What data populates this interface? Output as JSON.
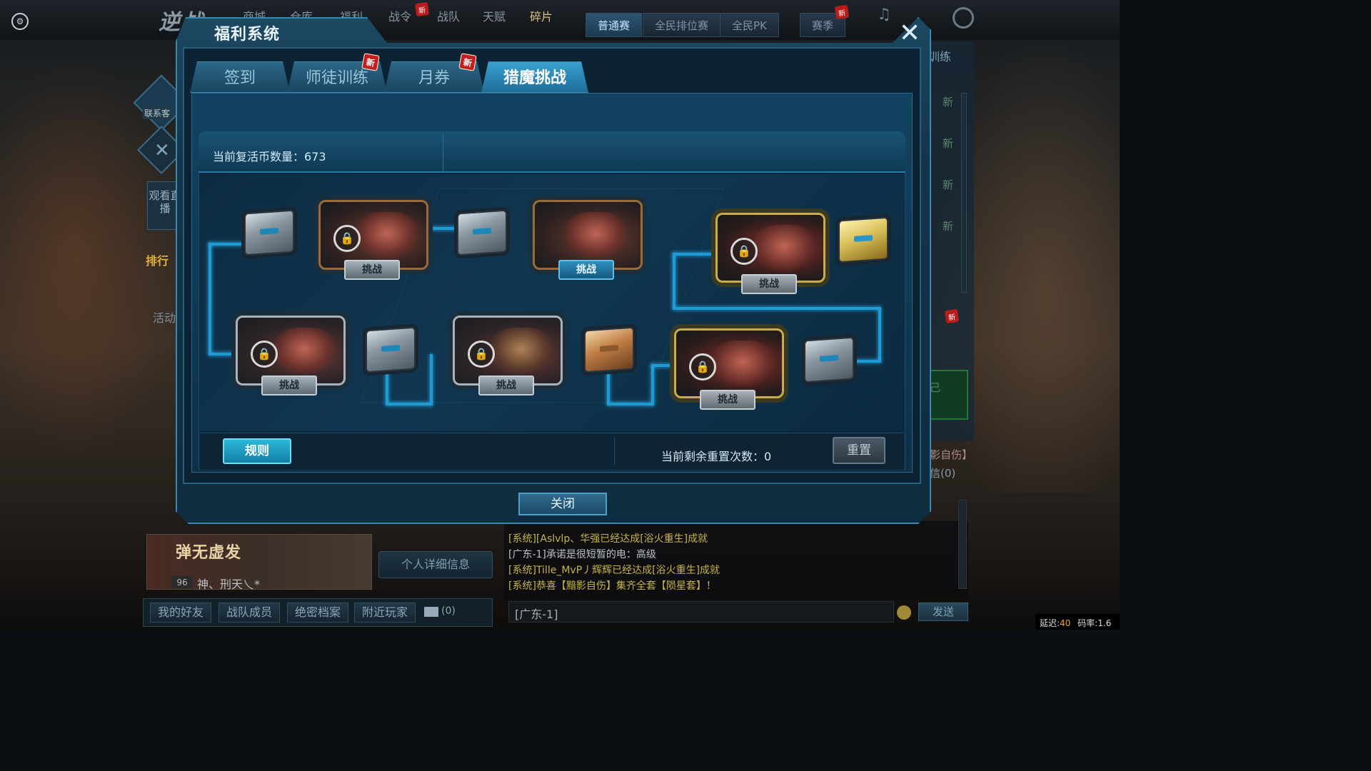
{
  "topbar": {
    "logo": "逆战",
    "nav_items": [
      "商城",
      "仓库",
      "福利",
      "战令",
      "战队",
      "天赋",
      "碎片"
    ],
    "mode_tabs": [
      "普通赛",
      "全民排位赛",
      "全民PK",
      "赛季"
    ],
    "new_badge": "新"
  },
  "sidebar": {
    "contact": "联系客",
    "watch_live": "观看直播",
    "rank": "排行",
    "activity": "活动"
  },
  "dialog": {
    "title": "福利系统",
    "tabs": [
      {
        "label": "签到",
        "active": false,
        "new": false
      },
      {
        "label": "师徒训练",
        "active": false,
        "new": true
      },
      {
        "label": "月券",
        "active": false,
        "new": true
      },
      {
        "label": "猎魔挑战",
        "active": true,
        "new": false
      }
    ],
    "new_badge": "新",
    "coin_label": "当前复活币数量：673",
    "challenge_label": "挑战",
    "lock_icon": "lock-icon",
    "rules_button": "规则",
    "reset_count_label": "当前剩余重置次数：0",
    "reset_button": "重置",
    "close_button": "关闭"
  },
  "right_panel": {
    "title": "训练",
    "new_tag": "新",
    "text1": "影自伤】",
    "text2": "信(0)",
    "green_text": "己"
  },
  "player": {
    "name": "弹无虚发",
    "level": "96",
    "title": "神、刑天乀*",
    "detail_button": "个人详细信息",
    "tabs": [
      "我的好友",
      "战队成员",
      "绝密档案",
      "附近玩家"
    ],
    "mail_count": "(0)"
  },
  "chat": {
    "lines": [
      {
        "text": "[系统][Aslvlp、华强已经达成[浴火重生]成就",
        "type": "sys"
      },
      {
        "text": "[广东-1]承诺是很短暂的电：高级",
        "type": "plain"
      },
      {
        "text": "[系统]Tille_MvP丿辉辉已经达成[浴火重生]成就",
        "type": "sys"
      },
      {
        "text": "[系统]恭喜【黯影自伤】集齐全套【陨星套】！",
        "type": "sys"
      }
    ],
    "channel": "[广东-1]",
    "send_button": "发送"
  },
  "status": {
    "latency_label": "延迟:",
    "latency_value": "40",
    "rate": "码率:1.6"
  }
}
